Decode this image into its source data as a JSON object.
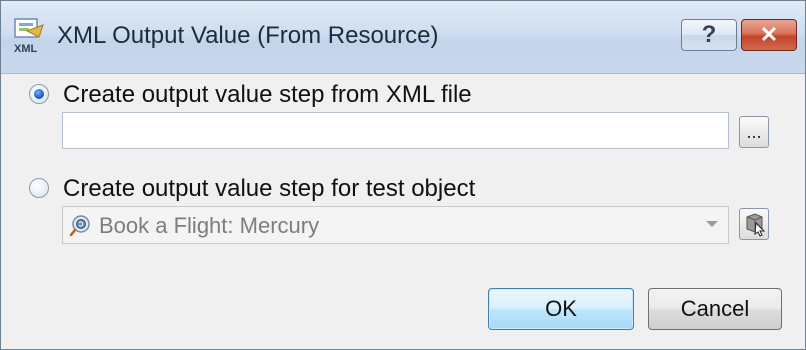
{
  "window": {
    "title": "XML Output Value (From Resource)",
    "icon": "xml-resource-icon",
    "help_button": "?",
    "close_button": "✕"
  },
  "option_file": {
    "label": "Create output value step from XML file",
    "selected": true,
    "file_path_value": "",
    "browse_label": "..."
  },
  "option_test_object": {
    "label": "Create output value step for test object",
    "selected": false,
    "object_value": "Book a Flight: Mercury",
    "object_icon": "browser-page-icon",
    "select_object_icon": "object-picker-icon"
  },
  "buttons": {
    "ok": "OK",
    "cancel": "Cancel"
  },
  "colors": {
    "titlebar": "#cfddef",
    "dialog_bg": "#f0f0f0",
    "close_button": "#c2432a",
    "default_button_border": "#3c7fb1"
  }
}
